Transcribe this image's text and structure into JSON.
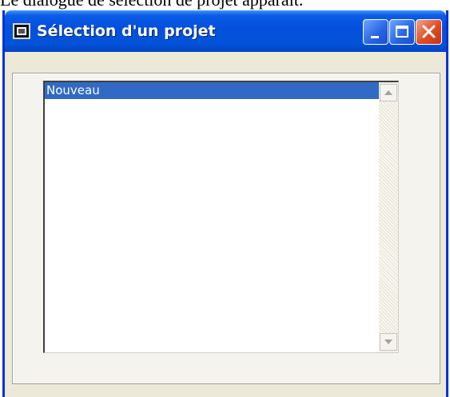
{
  "caption": "Le dialogue de sélection de projet apparaît.",
  "window": {
    "title": "Sélection d'un projet",
    "icon": "app-window-icon"
  },
  "titlebar_buttons": {
    "minimize_icon": "minimize-icon",
    "maximize_icon": "maximize-icon",
    "close_icon": "close-icon"
  },
  "project_list": {
    "items": [
      {
        "label": "Nouveau",
        "selected": true
      }
    ]
  },
  "colors": {
    "selection": "#316ac5",
    "titlebar": "#0450dd",
    "close_button": "#e04b22"
  }
}
